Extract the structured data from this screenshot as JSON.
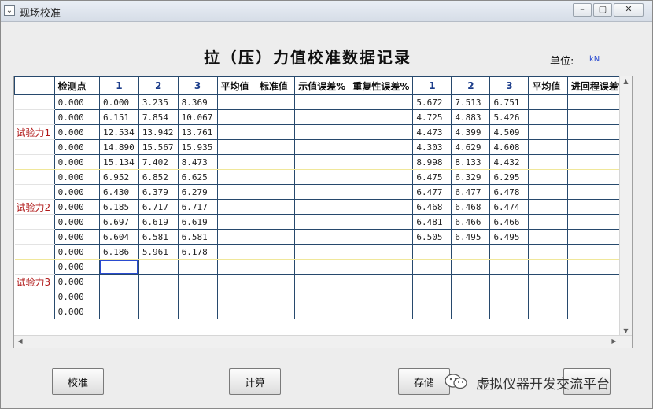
{
  "window": {
    "title": "现场校准",
    "min_icon": "minimize-icon",
    "max_icon": "maximize-icon",
    "close_icon": "close-icon"
  },
  "heading": "拉（压）力值校准数据记录",
  "unit": {
    "label": "单位:",
    "value": "kN"
  },
  "table": {
    "columns": [
      "",
      "检测点",
      "1",
      "2",
      "3",
      "平均值",
      "标准值",
      "示值误差%",
      "重复性误差%",
      "1",
      "2",
      "3",
      "平均值",
      "进回程误差%"
    ],
    "rows": [
      {
        "group": "",
        "cells": [
          "0.000",
          "0.000",
          "3.235",
          "8.369",
          "",
          "",
          "",
          "",
          "5.672",
          "7.513",
          "6.751",
          "",
          ""
        ]
      },
      {
        "group": "",
        "cells": [
          "0.000",
          "6.151",
          "7.854",
          "10.067",
          "",
          "",
          "",
          "",
          "4.725",
          "4.883",
          "5.426",
          "",
          ""
        ]
      },
      {
        "group": "试验力1",
        "cells": [
          "0.000",
          "12.534",
          "13.942",
          "13.761",
          "",
          "",
          "",
          "",
          "4.473",
          "4.399",
          "4.509",
          "",
          ""
        ]
      },
      {
        "group": "",
        "cells": [
          "0.000",
          "14.890",
          "15.567",
          "15.935",
          "",
          "",
          "",
          "",
          "4.303",
          "4.629",
          "4.608",
          "",
          ""
        ]
      },
      {
        "group": "",
        "cells": [
          "0.000",
          "15.134",
          "7.402",
          "8.473",
          "",
          "",
          "",
          "",
          "8.998",
          "8.133",
          "4.432",
          "",
          ""
        ]
      },
      {
        "group": "",
        "cells": [
          "0.000",
          "6.952",
          "6.852",
          "6.625",
          "",
          "",
          "",
          "",
          "6.475",
          "6.329",
          "6.295",
          "",
          ""
        ]
      },
      {
        "group": "",
        "cells": [
          "0.000",
          "6.430",
          "6.379",
          "6.279",
          "",
          "",
          "",
          "",
          "6.477",
          "6.477",
          "6.478",
          "",
          ""
        ]
      },
      {
        "group": "试验力2",
        "cells": [
          "0.000",
          "6.185",
          "6.717",
          "6.717",
          "",
          "",
          "",
          "",
          "6.468",
          "6.468",
          "6.474",
          "",
          ""
        ]
      },
      {
        "group": "",
        "cells": [
          "0.000",
          "6.697",
          "6.619",
          "6.619",
          "",
          "",
          "",
          "",
          "6.481",
          "6.466",
          "6.466",
          "",
          ""
        ]
      },
      {
        "group": "",
        "cells": [
          "0.000",
          "6.604",
          "6.581",
          "6.581",
          "",
          "",
          "",
          "",
          "6.505",
          "6.495",
          "6.495",
          "",
          ""
        ]
      },
      {
        "group": "",
        "cells": [
          "0.000",
          "6.186",
          "5.961",
          "6.178",
          "",
          "",
          "",
          "",
          "",
          "",
          "",
          "",
          ""
        ]
      },
      {
        "group": "",
        "cells": [
          "0.000",
          "",
          "",
          "",
          "",
          "",
          "",
          "",
          "",
          "",
          "",
          "",
          ""
        ]
      },
      {
        "group": "试验力3",
        "cells": [
          "0.000",
          "",
          "",
          "",
          "",
          "",
          "",
          "",
          "",
          "",
          "",
          "",
          ""
        ]
      },
      {
        "group": "",
        "cells": [
          "0.000",
          "",
          "",
          "",
          "",
          "",
          "",
          "",
          "",
          "",
          "",
          "",
          ""
        ]
      },
      {
        "group": "",
        "cells": [
          "0.000",
          "",
          "",
          "",
          "",
          "",
          "",
          "",
          "",
          "",
          "",
          "",
          ""
        ]
      }
    ]
  },
  "buttons": {
    "calibrate": "校准",
    "calculate": "计算",
    "save": "存储"
  },
  "watermark": {
    "icon": "wechat-icon",
    "text": "虚拟仪器开发交流平台"
  }
}
